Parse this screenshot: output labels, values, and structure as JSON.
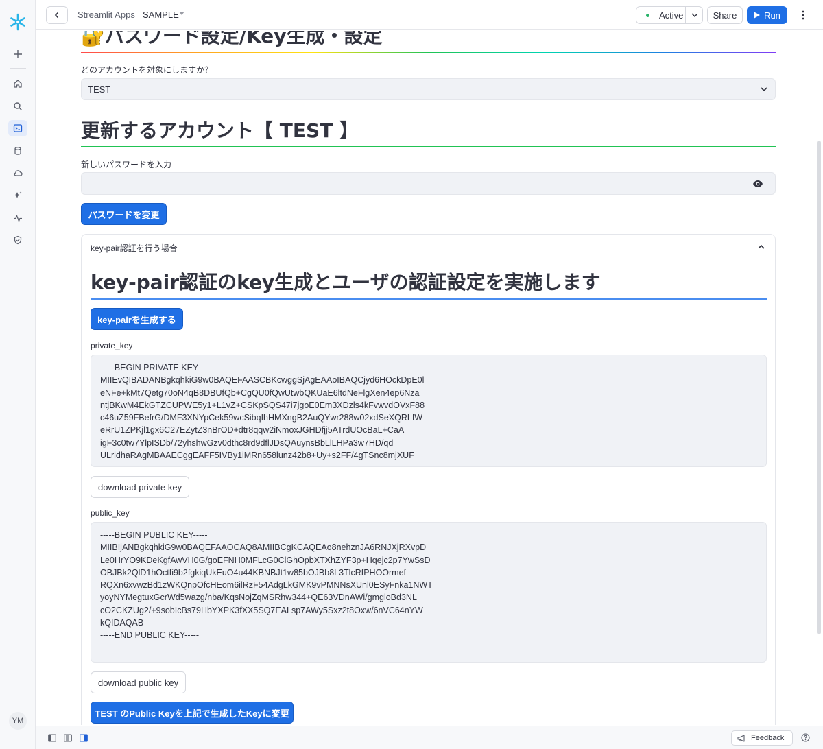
{
  "topbar": {
    "app_label": "Streamlit Apps",
    "app_name": "SAMPLE",
    "status_label": "Active",
    "share_label": "Share",
    "run_label": "Run"
  },
  "sidebar": {
    "avatar_initials": "YM",
    "items": [
      {
        "icon": "plus-icon"
      },
      {
        "icon": "home-icon"
      },
      {
        "icon": "search-icon"
      },
      {
        "icon": "terminal-icon",
        "active": true
      },
      {
        "icon": "database-icon"
      },
      {
        "icon": "cloud-icon"
      },
      {
        "icon": "sparkle-icon"
      },
      {
        "icon": "activity-icon"
      },
      {
        "icon": "shield-icon"
      }
    ]
  },
  "main": {
    "title1": "🔐パスワード設定/Key生成・設定",
    "account_select": {
      "label": "どのアカウントを対象にしますか？",
      "value": "TEST"
    },
    "title2": "更新するアカウント【 TEST 】",
    "password": {
      "label": "新しいパスワードを入力",
      "value": ""
    },
    "change_password_label": "パスワードを変更",
    "expander": {
      "header": "key-pair認証を行う場合",
      "title": "key-pair認証のkey生成とユーザの認証設定を実施します",
      "generate_label": "key-pairを生成する",
      "private_key_label": "private_key",
      "private_key_text": "-----BEGIN PRIVATE KEY-----\nMIIEvQIBADANBgkqhkiG9w0BAQEFAASCBKcwggSjAgEAAoIBAQCjyd6HOckDpE0l\neNFe+kMt7Qetg70oN4qB8DBUfQb+CgQU0fQwUtwbQKUaE6ltdNeFlgXen4ep6Nza\nntjBKwM4EkGTZCUPWE5y1+L1vZ+CSKpSQS47i7jgoE0Em3XDzls4kFvwvdOVxF88\nc46uZ59FBefrG/DMF3XNYpCek59wcSibqIhHMXngB2AuQYwr288w02xdSeXQRLIW\neRrU1ZPKjl1gx6C27EZytZ3nBrOD+dtr8qqw2iNmoxJGHDfjj5ATrdUOcBaL+CaA\nigF3c0tw7YlpISDb/72yhshwGzv0dthc8rd9dflJDsQAuynsBbLlLHPa3w7HD/qd\nULridhaRAgMBAAECggEAFF5IVBy1iMRn658lunz42b8+Uy+s2FF/4gTSnc8mjXUF",
      "download_private_label": "download private key",
      "public_key_label": "public_key",
      "public_key_text": "-----BEGIN PUBLIC KEY-----\nMIIBIjANBgkqhkiG9w0BAQEFAAOCAQ8AMIIBCgKCAQEAo8nehznJA6RNJXjRXvpD\nLe0HrYO9KDeKgfAwVH0G/goEFNH0MFLcG0ClGhOpbXTXhZYF3p+Hqejc2p7YwSsD\nOBJBk2QlD1hOctfi9b2fgkiqUkEuO4u44KBNBJt1w85bOJBb8L3TlcRfPHOOrmef\nRQXn6xvwzBd1zWKQnpOfcHEom6ilRzF54AdgLkGMK9vPMNNsXUnl0ESyFnka1NWT\nyoyNYMegtuxGcrWd5wazg/nba/KqsNojZqMSRhw344+QE63VDnAWi/gmgloBd3NL\ncO2CKZUg2/+9sobIcBs79HbYXPK3fXX5SQ7EALsp7AWy5Sxz2t8Oxw/6nVC64nYW\nkQIDAQAB\n-----END PUBLIC KEY-----",
      "download_public_label": "download public key",
      "change_key_label": "TEST のPublic Keyを上記で生成したKeyに変更"
    }
  },
  "bottombar": {
    "feedback_label": "Feedback"
  },
  "colors": {
    "primary": "#1f6fe5",
    "status_active": "#29b36a",
    "accent_green": "#21c354",
    "accent_blue": "#4a8df0"
  }
}
